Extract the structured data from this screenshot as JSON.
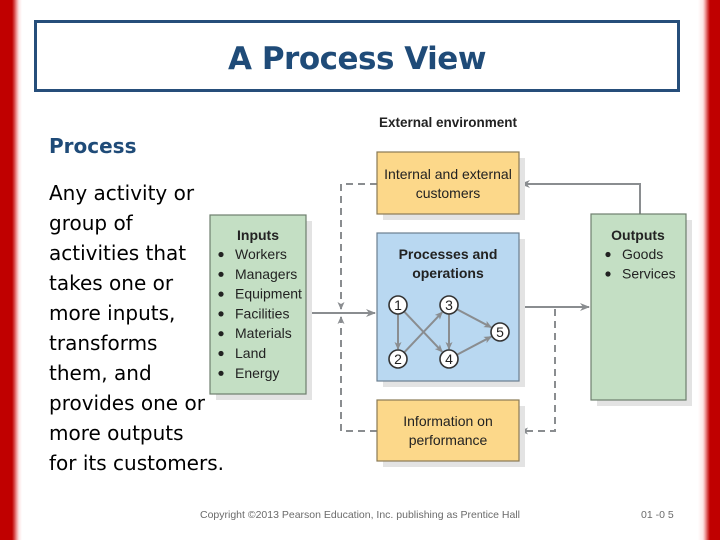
{
  "slide": {
    "title": "A Process View",
    "term": "Process",
    "definition": "Any activity or\ngroup of\nactivities that\ntakes one or\nmore inputs,\ntransforms\nthem, and\nprovides one or\nmore outputs\nfor its customers.",
    "footer_copyright": "Copyright ©2013 Pearson Education, Inc. publishing as Prentice Hall",
    "page_number": "01 -0 5"
  },
  "colors": {
    "frame_red": "#c00000",
    "title_blue": "#1f4b78",
    "yellow_box": "#fcd88a",
    "blue_box": "#b9d8f1",
    "green_box": "#c4dfc4",
    "connector_gray": "#8a8d90"
  },
  "diagram": {
    "environment_label": "External environment",
    "customers": {
      "line1": "Internal and external",
      "line2": "customers"
    },
    "inputs": {
      "heading": "Inputs",
      "items": [
        "Workers",
        "Managers",
        "Equipment",
        "Facilities",
        "Materials",
        "Land",
        "Energy"
      ]
    },
    "processes": {
      "line1": "Processes and",
      "line2": "operations"
    },
    "network": {
      "nodes": [
        "1",
        "2",
        "3",
        "4",
        "5"
      ],
      "edges": [
        [
          "1",
          "2"
        ],
        [
          "1",
          "4"
        ],
        [
          "2",
          "3"
        ],
        [
          "3",
          "4"
        ],
        [
          "3",
          "5"
        ],
        [
          "4",
          "5"
        ]
      ]
    },
    "outputs": {
      "heading": "Outputs",
      "items": [
        "Goods",
        "Services"
      ]
    },
    "information": {
      "line1": "Information on",
      "line2": "performance"
    }
  }
}
